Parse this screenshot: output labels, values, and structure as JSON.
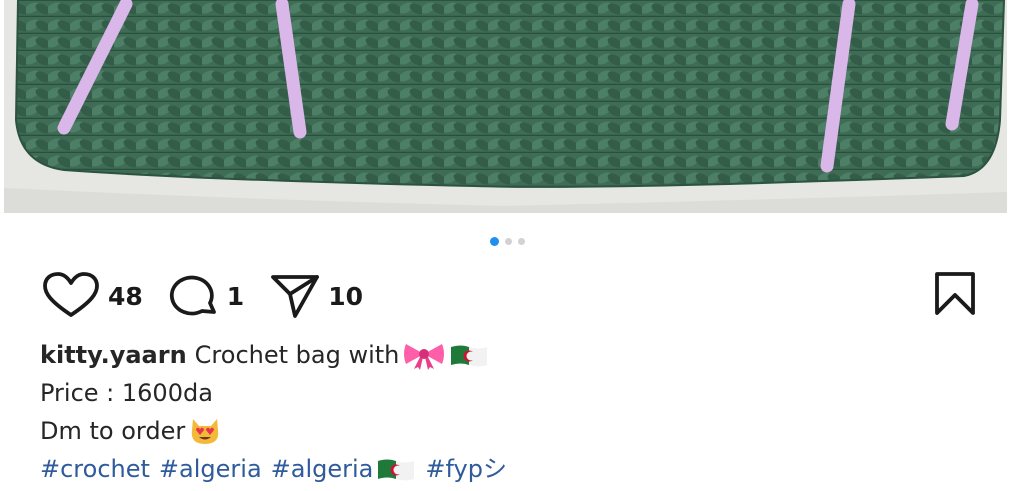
{
  "post": {
    "image": {
      "subject": "green crochet bag with lilac straps",
      "colors": {
        "yarn": "#3f6e57",
        "straps": "#d9b7e8",
        "background": "#e4e4e1"
      }
    },
    "carousel": {
      "total": 3,
      "active": 1,
      "active_color": "#1f8ff0"
    },
    "actions": {
      "like": {
        "icon": "heart-icon",
        "count": "48"
      },
      "comment": {
        "icon": "comment-icon",
        "count": "1"
      },
      "share": {
        "icon": "send-icon",
        "count": "10"
      },
      "save": {
        "icon": "bookmark-icon"
      }
    },
    "caption": {
      "username": "kitty.yaarn",
      "line1_text": "Crochet bag with",
      "line1_emojis": [
        "ribbon-emoji",
        "algeria-flag-emoji"
      ],
      "line2": "Price : 1600da",
      "line3_text": "Dm to order",
      "line3_emoji": "heart-eyes-cat-emoji",
      "hashtags": [
        "#crochet",
        "#algeria",
        "#algeria",
        "#fypシ"
      ],
      "hashtag_flag_after_index": 2,
      "hashtag_color": "#2f5b9c"
    }
  }
}
